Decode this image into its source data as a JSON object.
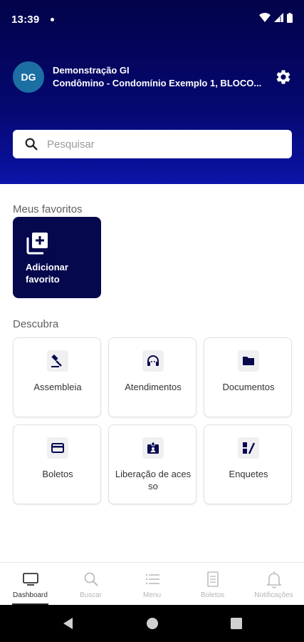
{
  "status": {
    "time": "13:39"
  },
  "header": {
    "avatar_initials": "DG",
    "user_name": "Demonstração GI",
    "user_subtitle": "Condômino - Condomínio Exemplo 1, BLOCO...",
    "search_placeholder": "Pesquisar"
  },
  "favorites": {
    "title": "Meus favoritos",
    "add_label": "Adicionar favorito"
  },
  "discover": {
    "title": "Descubra",
    "items": [
      {
        "label": "Assembleia",
        "icon": "gavel-icon"
      },
      {
        "label": "Atendimentos",
        "icon": "headset-icon"
      },
      {
        "label": "Documentos",
        "icon": "folder-icon"
      },
      {
        "label": "Boletos",
        "icon": "credit-card-icon"
      },
      {
        "label": "Liberação de acesso",
        "icon": "badge-icon"
      },
      {
        "label": "Enquetes",
        "icon": "poll-icon"
      }
    ]
  },
  "bottom_nav": [
    {
      "label": "Dashboard",
      "icon": "monitor-icon",
      "active": true
    },
    {
      "label": "Buscar",
      "icon": "search-icon"
    },
    {
      "label": "Menu",
      "icon": "menu-icon"
    },
    {
      "label": "Boletos",
      "icon": "bill-icon"
    },
    {
      "label": "Notificações",
      "icon": "bell-icon"
    }
  ],
  "colors": {
    "primary": "#06084e",
    "avatar": "#1c6fa3",
    "header_bottom": "#0b14a8"
  }
}
